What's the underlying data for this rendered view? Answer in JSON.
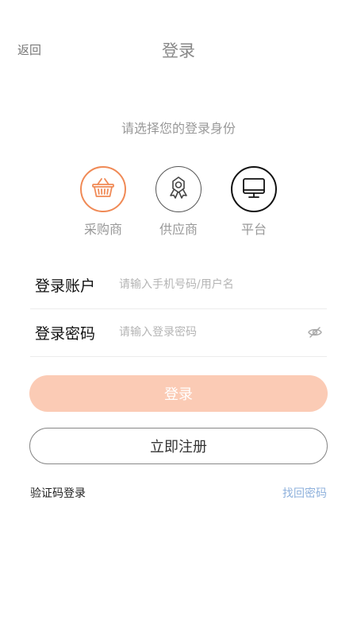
{
  "header": {
    "back_label": "返回",
    "title": "登录"
  },
  "role_prompt": "请选择您的登录身份",
  "roles": [
    {
      "label": "采购商",
      "icon": "basket-icon",
      "selected": true,
      "color": "#f08a56"
    },
    {
      "label": "供应商",
      "icon": "award-ribbon-icon",
      "selected": false,
      "color": "#555555"
    },
    {
      "label": "平台",
      "icon": "monitor-icon",
      "selected": false,
      "color": "#111111"
    }
  ],
  "form": {
    "account_label": "登录账户",
    "account_placeholder": "请输入手机号码/用户名",
    "account_value": "",
    "password_label": "登录密码",
    "password_placeholder": "请输入登录密码",
    "password_value": ""
  },
  "actions": {
    "login_label": "登录",
    "register_label": "立即注册",
    "sms_login_label": "验证码登录",
    "forgot_password_label": "找回密码"
  },
  "colors": {
    "accent": "#f08a56",
    "login_button_bg": "#fbcbb5",
    "link": "#8fb1dc"
  }
}
